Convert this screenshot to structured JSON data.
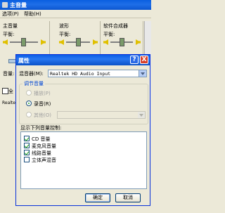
{
  "back_window": {
    "title": "主音量",
    "menu": [
      "选项(P)",
      "帮助(H)"
    ],
    "panels": [
      {
        "name": "主音量",
        "balance_label": "平衡:"
      },
      {
        "name": "波形",
        "balance_label": "平衡:"
      },
      {
        "name": "软件合成器",
        "balance_label": "平衡:"
      },
      {
        "name": "",
        "balance_label": ""
      }
    ],
    "volume_label": "音量:",
    "checkbox_fragment": "全",
    "status_fragment": "Realtek"
  },
  "dialog": {
    "title": "属性",
    "help_symbol": "?",
    "close_symbol": "X",
    "mixer_label": "混音器(M):",
    "mixer_value": "Realtek HD Audio Input",
    "adjust_group": "调节音量",
    "radios": [
      {
        "label": "播放(P)",
        "selected": false,
        "enabled": false
      },
      {
        "label": "录音(R)",
        "selected": true,
        "enabled": true
      },
      {
        "label": "其他(O)",
        "selected": false,
        "enabled": false
      }
    ],
    "show_controls_label": "显示下列音量控制:",
    "controls": [
      {
        "label": "CD 音量",
        "checked": true,
        "icon": "cd-icon"
      },
      {
        "label": "麦克风音量",
        "checked": true
      },
      {
        "label": "线路音量",
        "checked": true
      },
      {
        "label": "立体声混音",
        "checked": false
      }
    ],
    "ok_label": "确定",
    "cancel_label": "取消"
  }
}
